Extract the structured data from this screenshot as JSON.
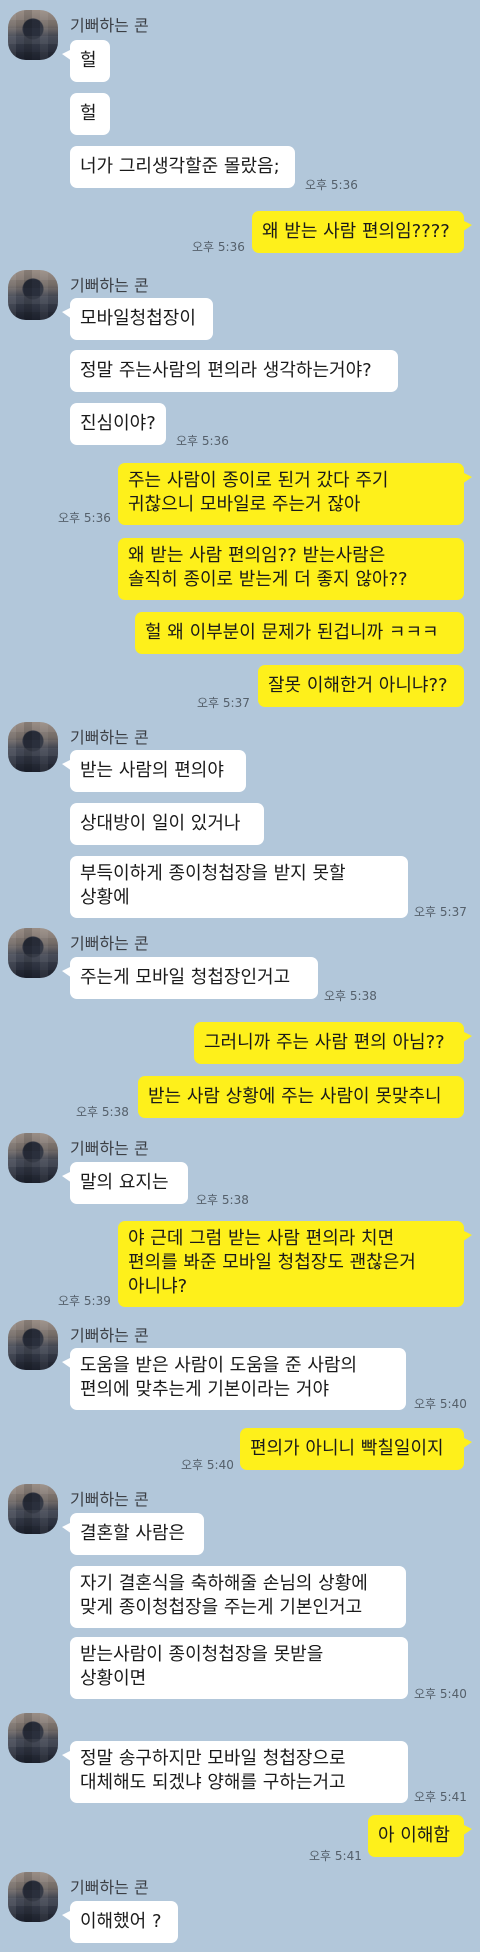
{
  "conversation": {
    "sender_name": "기뻐하는 콘",
    "messages": [
      {
        "from": "them",
        "text": "헐"
      },
      {
        "from": "them",
        "text": "헐"
      },
      {
        "from": "them",
        "text": "너가 그리생각할준 몰랐음;",
        "time": "오후 5:36"
      },
      {
        "from": "me",
        "text": "왜 받는 사람 편의임????",
        "time": "오후 5:36"
      },
      {
        "from": "them",
        "text": "모바일청첩장이"
      },
      {
        "from": "them",
        "text": "정말 주는사람의 편의라 생각하는거야?"
      },
      {
        "from": "them",
        "text": "진심이야?",
        "time": "오후 5:36"
      },
      {
        "from": "me",
        "lines": [
          "주는 사람이 종이로 된거 갔다 주기",
          "귀찮으니 모바일로 주는거 잖아"
        ],
        "time": "오후 5:36"
      },
      {
        "from": "me",
        "lines": [
          "왜 받는 사람 편의임?? 받는사람은",
          "솔직히 종이로 받는게 더 좋지 않아??"
        ]
      },
      {
        "from": "me",
        "text": "헐 왜 이부분이 문제가 된겁니까 ㅋㅋㅋ"
      },
      {
        "from": "me",
        "text": "잘못 이해한거 아니냐??",
        "time": "오후 5:37"
      },
      {
        "from": "them",
        "text": "받는 사람의 편의야"
      },
      {
        "from": "them",
        "text": "상대방이 일이 있거나"
      },
      {
        "from": "them",
        "lines": [
          "부득이하게 종이청첩장을 받지 못할",
          "상황에"
        ],
        "time": "오후 5:37"
      },
      {
        "from": "them",
        "text": "주는게 모바일 청첩장인거고",
        "time": "오후 5:38"
      },
      {
        "from": "me",
        "text": "그러니까 주는 사람 편의 아님??"
      },
      {
        "from": "me",
        "text": "받는 사람 상황에 주는 사람이 못맞추니",
        "time": "오후 5:38"
      },
      {
        "from": "them",
        "text": "말의 요지는",
        "time": "오후 5:38"
      },
      {
        "from": "me",
        "lines": [
          "야 근데 그럼 받는 사람 편의라 치면",
          "편의를 봐준 모바일 청첩장도 괜찮은거",
          "아니냐?"
        ],
        "time": "오후 5:39"
      },
      {
        "from": "them",
        "lines": [
          "도움을 받은 사람이 도움을 준 사람의",
          "편의에 맞추는게 기본이라는 거야"
        ],
        "time": "오후 5:40"
      },
      {
        "from": "me",
        "text": "편의가 아니니 빡칠일이지",
        "time": "오후 5:40"
      },
      {
        "from": "them",
        "text": "결혼할 사람은"
      },
      {
        "from": "them",
        "lines": [
          "자기 결혼식을 축하해줄 손님의 상황에",
          "맞게 종이청첩장을 주는게 기본인거고"
        ]
      },
      {
        "from": "them",
        "lines": [
          "받는사람이 종이청첩장을 못받을",
          "상황이면"
        ],
        "time": "오후 5:40"
      },
      {
        "from": "them",
        "lines": [
          "정말 송구하지만 모바일 청첩장으로",
          "대체해도 되겠냐 양해를 구하는거고"
        ],
        "time": "오후 5:41"
      },
      {
        "from": "me",
        "text": "아 이해함",
        "time": "오후 5:41"
      },
      {
        "from": "them",
        "text": "이해했어 ?"
      }
    ]
  },
  "colors": {
    "background": "#b2c7da",
    "incoming_bubble": "#ffffff",
    "outgoing_bubble": "#fef01b"
  },
  "icons": {
    "avatar": "blurred-profile-avatar"
  }
}
